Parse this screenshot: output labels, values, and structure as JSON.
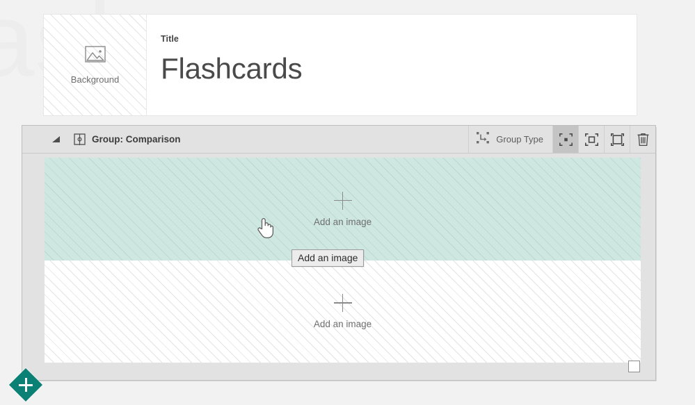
{
  "app": {
    "watermark_text": "ash",
    "background_color": "#f2f2f2",
    "accent_color": "#0b8074",
    "teal_panel_color": "#cee7e1"
  },
  "title_card": {
    "background_thumb": {
      "icon": "image-placeholder-icon",
      "label": "Background"
    },
    "field_label": "Title",
    "title_value": "Flashcards"
  },
  "group_panel": {
    "collapse_icon": "collapse-triangle-icon",
    "group_icon": "split-group-icon",
    "heading": "Group: Comparison",
    "toolbar": {
      "group_type": {
        "icon": "marquee-arrow-icon",
        "label": "Group Type"
      },
      "layout_buttons": [
        {
          "name": "layout-small-icon",
          "selected": true
        },
        {
          "name": "layout-medium-icon",
          "selected": false
        },
        {
          "name": "layout-large-icon",
          "selected": false
        }
      ],
      "delete": {
        "icon": "trash-icon",
        "label": "Delete"
      }
    },
    "slots": [
      {
        "icon": "plus-icon",
        "label": "Add an image",
        "state": "hover",
        "fill": "#cee7e1"
      },
      {
        "icon": "plus-icon",
        "label": "Add an image",
        "state": "normal",
        "fill": "#ffffff"
      }
    ],
    "select_checkbox": {
      "checked": false
    }
  },
  "tooltip": {
    "text": "Add an image"
  },
  "add_button": {
    "icon": "plus-icon",
    "label": "Add"
  },
  "cursor": {
    "type": "pointing-hand-cursor"
  }
}
